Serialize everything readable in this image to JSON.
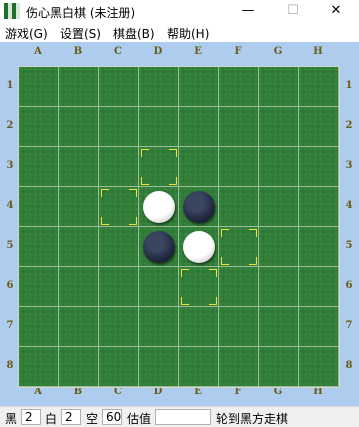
{
  "window": {
    "title": "伤心黑白棋 (未注册)",
    "buttons": {
      "minimize": "—",
      "maximize": "☐",
      "close": "✕"
    }
  },
  "menu": [
    "游戏(G)",
    "设置(S)",
    "棋盘(B)",
    "帮助(H)"
  ],
  "board": {
    "columns": [
      "A",
      "B",
      "C",
      "D",
      "E",
      "F",
      "G",
      "H"
    ],
    "rows": [
      "1",
      "2",
      "3",
      "4",
      "5",
      "6",
      "7",
      "8"
    ],
    "pieces": [
      {
        "cell": "D4",
        "color": "white"
      },
      {
        "cell": "E4",
        "color": "black"
      },
      {
        "cell": "D5",
        "color": "black"
      },
      {
        "cell": "E5",
        "color": "white"
      }
    ],
    "legal_moves": [
      "D3",
      "C4",
      "F5",
      "E6"
    ],
    "colors": {
      "felt": "#2f7d36",
      "frame": "#aecdee",
      "hint": "#f2e23a",
      "label": "#6a5a12"
    }
  },
  "status": {
    "black_label": "黑",
    "black_count": "2",
    "white_label": "白",
    "white_count": "2",
    "empty_label": "空",
    "empty_count": "60",
    "eval_label": "估值",
    "eval_value": "",
    "message": "轮到黑方走棋"
  }
}
